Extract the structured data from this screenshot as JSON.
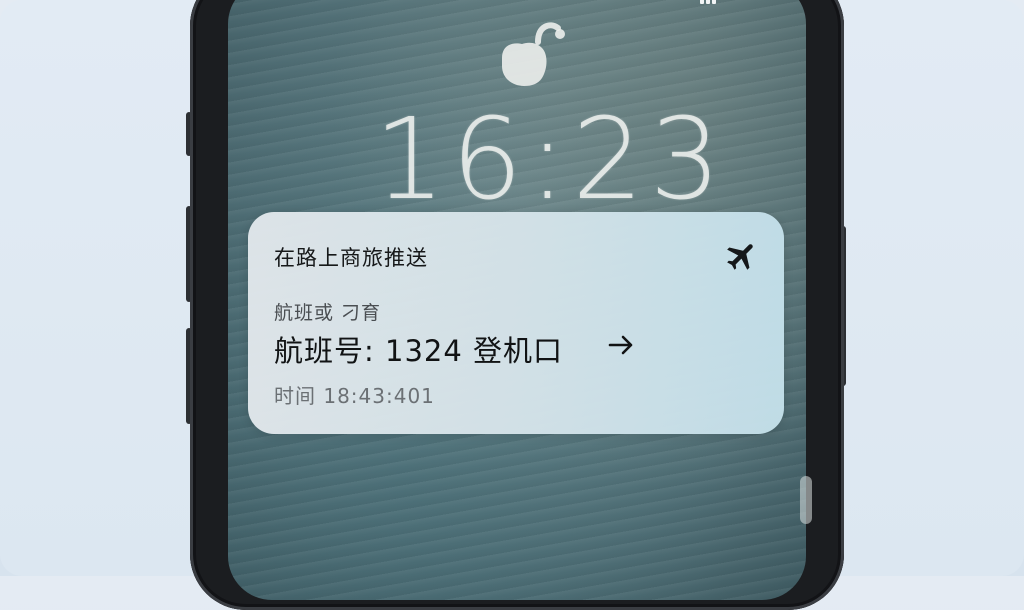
{
  "lock_screen": {
    "time": "16:23",
    "lock_icon": "lock-open-icon"
  },
  "notification": {
    "app_name": "在路上商旅推送",
    "app_icon": "airplane-icon",
    "subtitle": "航班或 刁育",
    "main_text": "航班号: 1324 登机口",
    "arrow_icon": "arrow-right-icon",
    "time_text": "时间 18:43:401"
  },
  "colors": {
    "background": "#e0e9f2",
    "phone_frame": "#1b1d20",
    "notification_bg": "#d8e6ec",
    "text_primary": "#111314",
    "text_secondary": "#6b7074"
  }
}
